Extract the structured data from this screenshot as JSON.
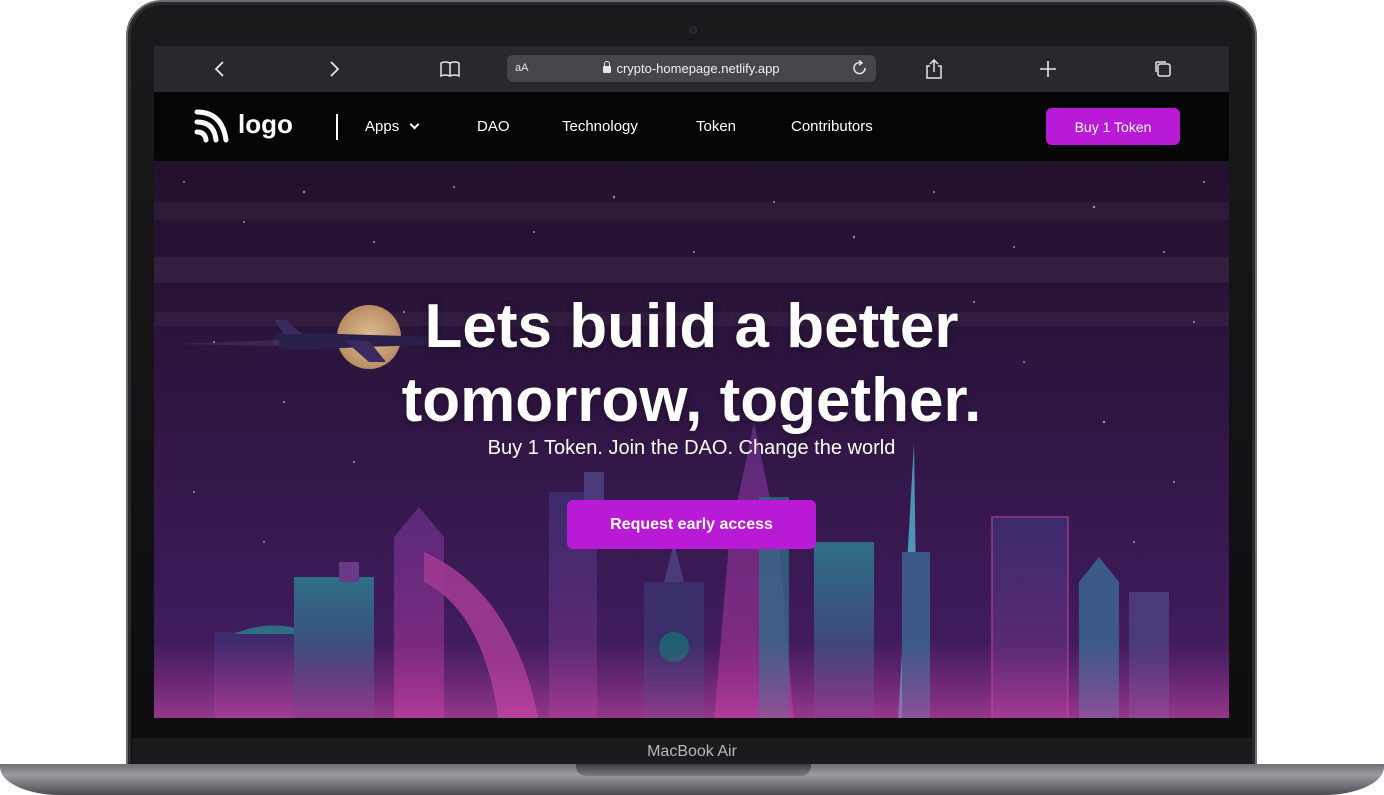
{
  "device": {
    "label": "MacBook Air"
  },
  "browser": {
    "url_prefix": "aA",
    "url": "crypto-homepage.netlify.app",
    "icons": [
      "back-icon",
      "forward-icon",
      "book-icon",
      "lock-icon",
      "reload-icon",
      "share-icon",
      "new-tab-icon",
      "tabs-icon"
    ]
  },
  "nav": {
    "logo_text": "logo",
    "apps_label": "Apps",
    "links": [
      "DAO",
      "Technology",
      "Token",
      "Contributors"
    ],
    "cta_label": "Buy 1 Token"
  },
  "hero": {
    "title_line1": "Lets build a better",
    "title_line2": "tomorrow, together.",
    "subtitle": "Buy 1 Token. Join the DAO. Change the world",
    "cta_label": "Request early access"
  },
  "colors": {
    "accent": "#b81ad6",
    "nav_bg": "#050505",
    "hero_bg": "#2e1540",
    "browser_bar": "#28292e"
  }
}
